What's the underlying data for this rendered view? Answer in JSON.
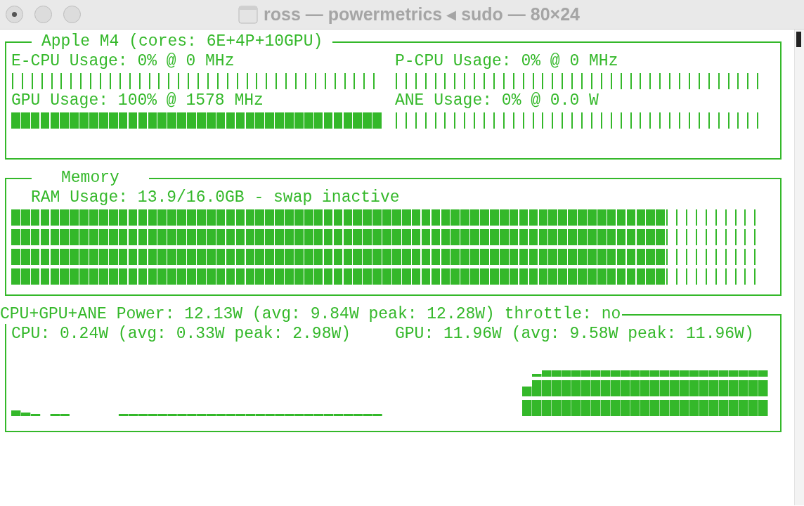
{
  "window": {
    "title": "ross — powermetrics ◂ sudo — 80×24"
  },
  "processor": {
    "title": "Apple M4 (cores: 6E+4P+10GPU)",
    "gauges": [
      {
        "label": "E-CPU Usage: 0% @ 0 MHz",
        "level": 0
      },
      {
        "label": "P-CPU Usage: 0% @ 0 MHz",
        "level": 0
      },
      {
        "label": "GPU Usage: 100% @ 1578 MHz",
        "level": 1
      },
      {
        "label": "ANE Usage: 0% @ 0.0 W",
        "level": 0
      }
    ]
  },
  "memory": {
    "title": "Memory",
    "label": "RAM Usage: 13.9/16.0GB - swap inactive",
    "level": 0.87
  },
  "power": {
    "title": "CPU+GPU+ANE Power: 12.13W (avg: 9.84W peak: 12.28W) throttle: no",
    "charts": [
      {
        "kind": "cpu",
        "label": "CPU: 0.24W (avg: 0.33W peak: 2.98W)"
      },
      {
        "kind": "gpu",
        "label": "GPU: 11.96W (avg: 9.58W peak: 11.96W)"
      }
    ]
  }
}
